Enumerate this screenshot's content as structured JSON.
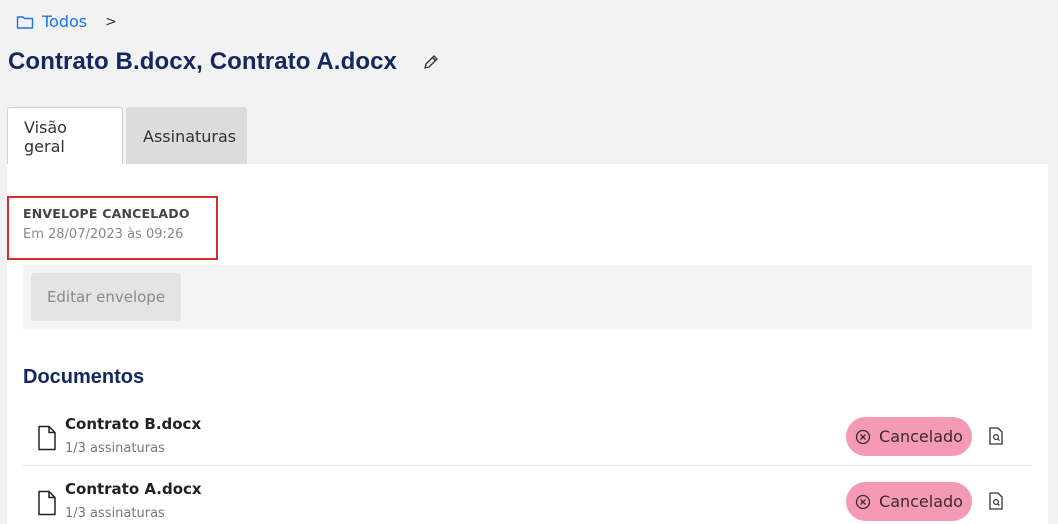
{
  "breadcrumb": {
    "root_label": "Todos",
    "separator": ">"
  },
  "title": "Contrato B.docx, Contrato A.docx",
  "tabs": [
    {
      "label": "Visão geral",
      "active": true
    },
    {
      "label": "Assinaturas",
      "active": false
    }
  ],
  "status": {
    "title": "ENVELOPE CANCELADO",
    "date": "Em 28/07/2023 às 09:26"
  },
  "actions": {
    "edit_label": "Editar envelope"
  },
  "documents": {
    "heading": "Documentos",
    "items": [
      {
        "name": "Contrato B.docx",
        "signatures": "1/3 assinaturas",
        "status": "Cancelado"
      },
      {
        "name": "Contrato A.docx",
        "signatures": "1/3 assinaturas",
        "status": "Cancelado"
      }
    ]
  },
  "colors": {
    "accent_blue": "#1a73e8",
    "title_navy": "#142860",
    "cancel_badge": "#f59ab4",
    "highlight_red": "#d32f2f"
  },
  "icons": {
    "breadcrumb": "folder-icon",
    "title_edit": "pencil-icon",
    "document": "file-icon",
    "badge": "x-circle-icon",
    "preview": "file-search-icon"
  }
}
